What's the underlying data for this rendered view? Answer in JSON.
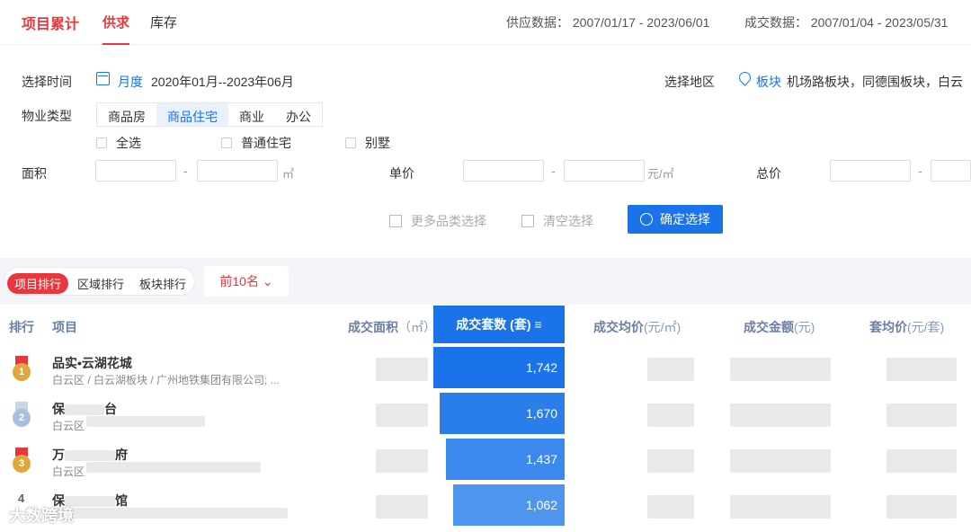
{
  "header": {
    "tab_cumulative": "项目累计",
    "tab_supply_deal": "供求",
    "tab_inventory": "库存",
    "supply_data": "供应数据： 2007/01/17 - 2023/06/01",
    "deal_data": "成交数据： 2007/01/04 - 2023/05/31"
  },
  "filters": {
    "time_label": "选择时间",
    "time_mode": "月度",
    "time_range": "2020年01月--2023年06月",
    "region_label": "选择地区",
    "region_mode": "板块",
    "region_list": "机场路板块，同德围板块，白云",
    "property_label": "物业类型",
    "property_types": [
      "商品房",
      "商品住宅",
      "商业",
      "办公"
    ],
    "property_selected": "商品住宅",
    "checkboxes": [
      "全选",
      "普通住宅",
      "别墅"
    ],
    "area_label": "面积",
    "area_unit": "㎡",
    "price_label": "单价",
    "price_unit": "元/㎡",
    "total_label": "总价",
    "dash": "-",
    "more_categories": "更多品类选择",
    "clear": "清空选择",
    "confirm": "确定选择"
  },
  "ranking": {
    "tabs": [
      "项目排行",
      "区域排行",
      "板块排行"
    ],
    "active_tab": "项目排行",
    "top_n": "前10名 ⌄"
  },
  "table": {
    "headers": {
      "rank": "排行",
      "project": "项目",
      "deal_area": "成交面积",
      "deal_area_unit": "（㎡）",
      "deal_units": "成交套数 (套)",
      "avg_price": "成交均价",
      "avg_price_unit": "(元/㎡)",
      "deal_amount": "成交金额",
      "deal_amount_unit": "(元)",
      "unit_avg": "套均价",
      "unit_avg_unit": "(元/套)"
    },
    "rows": [
      {
        "rank": "1",
        "name": "品实•云湖花城",
        "sub": "白云区 / 白云湖板块 / 广州地铁集团有限公司; ...",
        "units": "1,742",
        "fraction": 1.0
      },
      {
        "rank": "2",
        "name": "保",
        "name_tail": "台",
        "sub": "白云区",
        "units": "1,670",
        "fraction": 0.959
      },
      {
        "rank": "3",
        "name": "万",
        "name_tail": "府",
        "sub": "白云区",
        "units": "1,437",
        "fraction": 0.825
      },
      {
        "rank": "4",
        "name": "保",
        "name_tail": "馆",
        "sub": "",
        "units": "1,062",
        "fraction": 0.61
      }
    ]
  },
  "watermark": "大数跨境",
  "colors": {
    "brand_red": "#e8383d",
    "primary_blue": "#1a73e8"
  }
}
